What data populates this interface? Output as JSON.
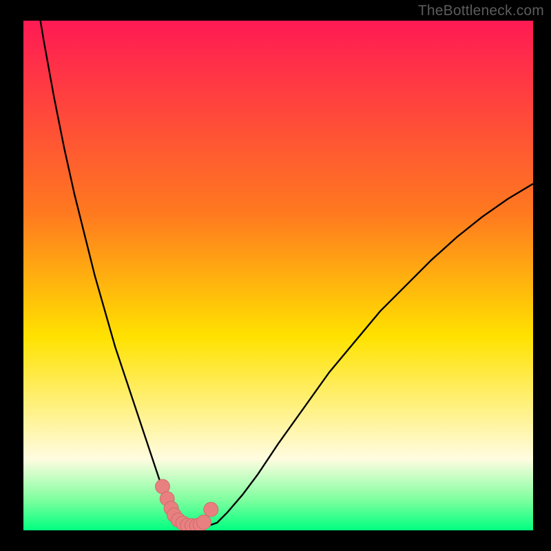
{
  "watermark": "TheBottleneck.com",
  "colors": {
    "bg_black": "#000000",
    "grad_top": "#ff1a54",
    "grad_mid1": "#ff7a1f",
    "grad_mid2": "#ffe200",
    "grad_low1": "#fffce0",
    "grad_low2": "#7fff9f",
    "grad_bottom": "#00ff80",
    "curve": "#000000",
    "marker_fill": "#e88080",
    "marker_stroke": "#cf6b6b"
  },
  "chart_data": {
    "type": "line",
    "title": "",
    "xlabel": "",
    "ylabel": "",
    "xlim": [
      0,
      100
    ],
    "ylim": [
      0,
      100
    ],
    "series": [
      {
        "name": "bottleneck-curve",
        "x": [
          0,
          2,
          4,
          6,
          8,
          10,
          12,
          14,
          16,
          18,
          20,
          22,
          24,
          26,
          27,
          28,
          29,
          30,
          31,
          32,
          33,
          34,
          36,
          38,
          40,
          43,
          46,
          50,
          55,
          60,
          65,
          70,
          75,
          80,
          85,
          90,
          95,
          100
        ],
        "values": [
          120,
          108,
          96,
          85,
          75,
          66,
          58,
          50,
          43,
          36,
          30,
          24,
          18,
          12,
          9,
          6.5,
          4.5,
          3,
          2,
          1.4,
          1.0,
          0.8,
          0.8,
          1.5,
          3.5,
          7,
          11,
          17,
          24,
          31,
          37,
          43,
          48,
          53,
          57.5,
          61.5,
          65,
          68
        ]
      }
    ],
    "markers": {
      "name": "highlight-points",
      "x": [
        27.3,
        28.2,
        29.0,
        29.6,
        30.4,
        31.3,
        32.2,
        33.1,
        34.0,
        34.7,
        35.4,
        36.8
      ],
      "y": [
        8.6,
        6.2,
        4.3,
        3.0,
        2.0,
        1.4,
        1.0,
        0.9,
        0.9,
        1.1,
        1.6,
        4.1
      ],
      "radius_pct": 1.4
    }
  }
}
